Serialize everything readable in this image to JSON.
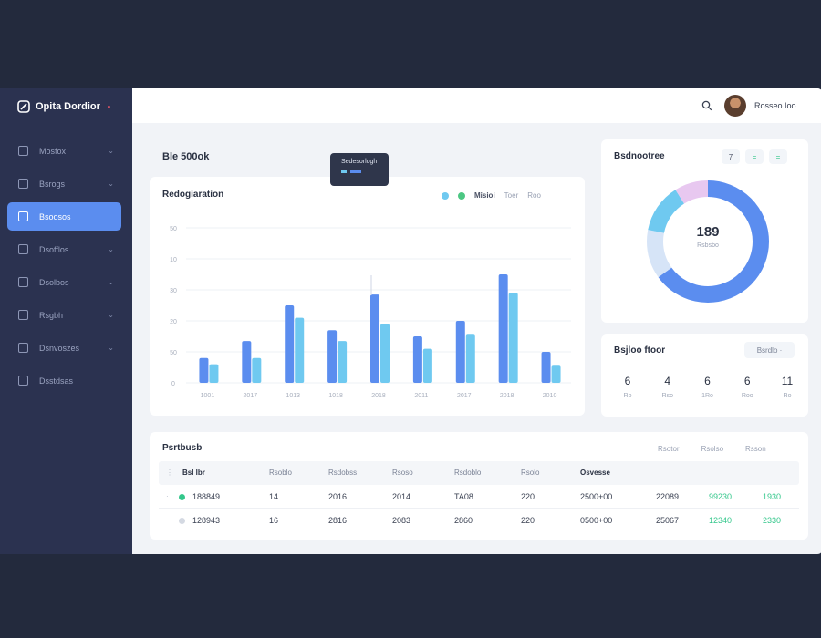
{
  "app": {
    "brand": "Opita Dordior"
  },
  "sidebar": {
    "items": [
      {
        "label": "Mosfox",
        "icon": "monitor-icon",
        "active": false
      },
      {
        "label": "Bsrogs",
        "icon": "document-icon",
        "active": false
      },
      {
        "label": "Bsoosos",
        "icon": "list-icon",
        "active": true
      },
      {
        "label": "Dsofflos",
        "icon": "inbox-icon",
        "active": false
      },
      {
        "label": "Dsolbos",
        "icon": "chart-icon",
        "active": false
      },
      {
        "label": "Rsgbh",
        "icon": "tag-icon",
        "active": false
      },
      {
        "label": "Dsnvoszes",
        "icon": "calendar-icon",
        "active": false
      },
      {
        "label": "Dsstdsas",
        "icon": "grid-icon",
        "active": false
      }
    ]
  },
  "header": {
    "user_name": "Rosseo Ioo"
  },
  "page": {
    "title": "Ble 500ok"
  },
  "bar_card": {
    "title": "Redogiaration",
    "legend": [
      "Misioi",
      "Toer",
      "Roo"
    ],
    "legend_colors": [
      "#6fc9f0",
      "#4cc783"
    ],
    "tooltip_title": "Sedesorlogh"
  },
  "chart_data": {
    "type": "bar",
    "categories": [
      "1001",
      "2017",
      "1013",
      "1018",
      "2018",
      "2011",
      "2017",
      "2018",
      "2010"
    ],
    "series": [
      {
        "values": [
          8,
          13.5,
          25,
          17,
          28.5,
          15,
          20,
          35,
          10
        ],
        "color": "#5b8def"
      },
      {
        "values": [
          6,
          8,
          21,
          13.5,
          19,
          11,
          15.5,
          29,
          5.5
        ],
        "color": "#6fc9f0"
      }
    ],
    "y_ticks": [
      "0",
      "50",
      "20",
      "30",
      "10",
      "50"
    ],
    "ylim": [
      0,
      50
    ],
    "grid": true
  },
  "donut_card": {
    "title": "Bsdnootree",
    "buttons": [
      "7",
      "=",
      "="
    ],
    "center_value": "189",
    "center_sub": "Rsbsbo",
    "segments": [
      {
        "value": 65,
        "color": "#5b8def"
      },
      {
        "value": 13,
        "color": "#d6e4f7"
      },
      {
        "value": 13,
        "color": "#6fc9f0"
      },
      {
        "value": 9,
        "color": "#e8c8f0"
      }
    ]
  },
  "stats_card": {
    "title": "Bsjloo ftoor",
    "button": "Bsrdlo ·",
    "stats": [
      {
        "value": "6",
        "label": "Ro"
      },
      {
        "value": "4",
        "label": "Rso"
      },
      {
        "value": "6",
        "label": "1Ro"
      },
      {
        "value": "6",
        "label": "Roo"
      },
      {
        "value": "11",
        "label": "Ro"
      }
    ]
  },
  "table": {
    "title": "Psrtbusb",
    "right_headers": [
      "Rsotor",
      "Rsolso",
      "Rsson"
    ],
    "columns": [
      "Bsl lbr",
      "Rsoblo",
      "Rsdobss",
      "Rsoso",
      "Rsdoblo",
      "Rsolo",
      "Osvesse",
      "",
      "",
      ""
    ],
    "rows": [
      {
        "index": "·",
        "dot_color": "#33c78b",
        "cells": [
          "188849",
          "14",
          "2016",
          "2014",
          "TA08",
          "220",
          "2500+00",
          "22089",
          "99230",
          "1930"
        ]
      },
      {
        "index": "·",
        "dot_color": "#d4d9e2",
        "cells": [
          "128943",
          "16",
          "2816",
          "2083",
          "2860",
          "220",
          "0500+00",
          "25067",
          "12340",
          "2330"
        ]
      }
    ]
  }
}
